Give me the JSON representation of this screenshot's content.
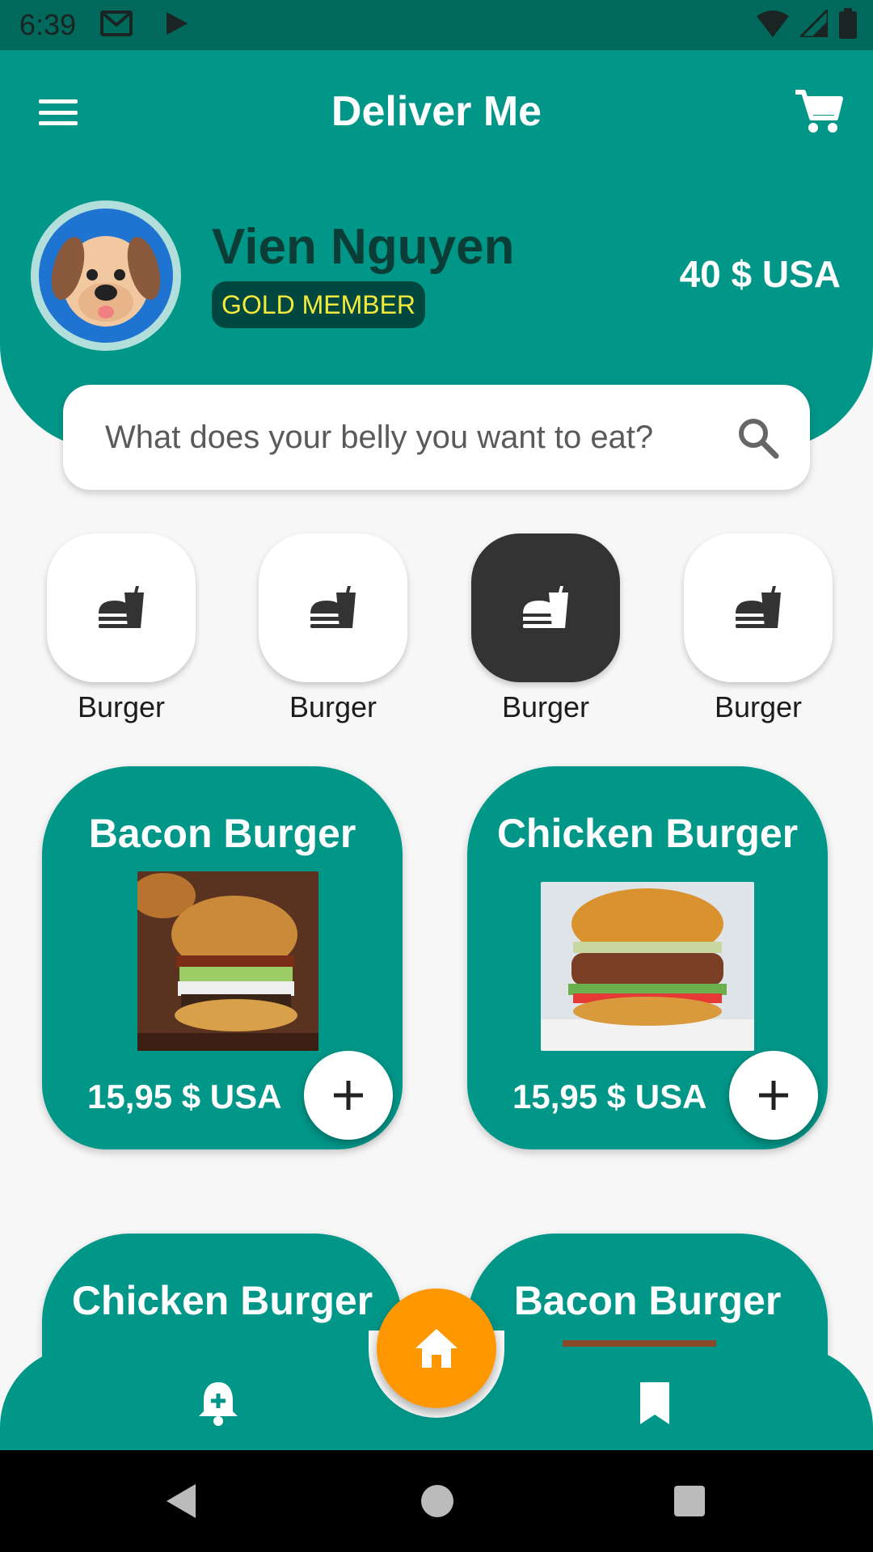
{
  "status_bar": {
    "time": "6:39",
    "icons": [
      "gmail-icon",
      "play-store-icon",
      "wifi-icon",
      "signal-icon",
      "battery-icon"
    ]
  },
  "app_bar": {
    "title": "Deliver Me",
    "icons": [
      "menu-icon",
      "cart-icon"
    ]
  },
  "profile": {
    "name": "Vien Nguyen",
    "membership": "GOLD MEMBER",
    "balance": "40 $ USA"
  },
  "search": {
    "placeholder": "What does your belly you want to eat?"
  },
  "categories": [
    {
      "label": "Burger",
      "icon": "fastfood-icon",
      "selected": false
    },
    {
      "label": "Burger",
      "icon": "fastfood-icon",
      "selected": false
    },
    {
      "label": "Burger",
      "icon": "fastfood-icon",
      "selected": true
    },
    {
      "label": "Burger",
      "icon": "fastfood-icon",
      "selected": false
    }
  ],
  "food_items": [
    {
      "name": "Bacon Burger",
      "price": "15,95 $ USA"
    },
    {
      "name": "Chicken Burger",
      "price": "15,95 $ USA"
    },
    {
      "name": "Chicken Burger"
    },
    {
      "name": "Bacon Burger"
    }
  ],
  "bottom_nav": {
    "items": [
      "notification-add-icon",
      "home-icon",
      "bookmark-icon"
    ],
    "active": "home-icon"
  },
  "system_nav": [
    "back-icon",
    "home-circle-icon",
    "recents-icon"
  ],
  "colors": {
    "primary": "#009688",
    "primary_dark": "#00695c",
    "accent": "#ff9800",
    "badge_bg": "#00483f",
    "badge_text": "#f5ea3c"
  }
}
